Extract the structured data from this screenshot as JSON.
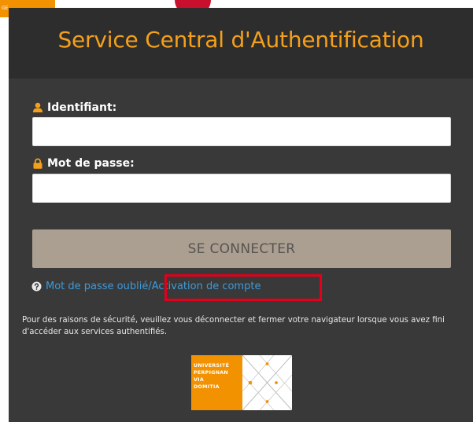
{
  "corner_tab": {
    "label": "GE"
  },
  "header": {
    "title": "Service Central d'Authentification"
  },
  "form": {
    "username": {
      "label": "Identifiant:",
      "icon": "user-icon",
      "value": ""
    },
    "password": {
      "label": "Mot de passe:",
      "icon": "lock-icon",
      "value": ""
    },
    "submit_label": "SE CONNECTER"
  },
  "help": {
    "icon": "question-circle-icon",
    "forgot_label": "Mot de passe oublié",
    "separator": "/",
    "activation_label": "Activation de compte"
  },
  "notice": {
    "text": "Pour des raisons de sécurité, veuillez vous déconnecter et fermer votre navigateur lorsque vous avez fini d'accéder aux services authentifiés."
  },
  "logo": {
    "lines": [
      "UNIVERSITÉ",
      "PERPIGNAN",
      "VIA",
      "DOMITIA"
    ]
  },
  "colors": {
    "title": "#f5a01a",
    "panel_dark": "#2d2d2d",
    "form_bg": "#393939",
    "button_bg": "#aa9f91",
    "link": "#3e9ad9",
    "highlight_box": "#e2001a",
    "brand_orange": "#f39200"
  }
}
